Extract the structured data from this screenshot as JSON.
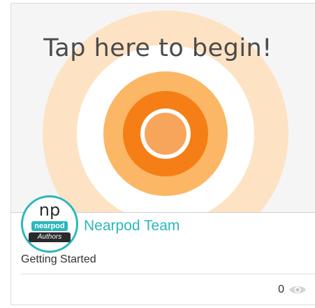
{
  "thumbnail": {
    "title": "Tap here to begin!",
    "icon": "target-icon",
    "colors": {
      "outer_ring": "#fde3c4",
      "middle_ring": "#fbb765",
      "inner_ring": "#f57f16",
      "center": "#f8a55c"
    }
  },
  "author": {
    "logo": {
      "mark": "np",
      "word": "nearpod",
      "sub": "Authors"
    },
    "name": "Nearpod Team"
  },
  "lesson": {
    "title": "Getting Started"
  },
  "stats": {
    "views": "0",
    "views_icon": "eye-icon"
  },
  "colors": {
    "accent": "#2bb6bd"
  }
}
